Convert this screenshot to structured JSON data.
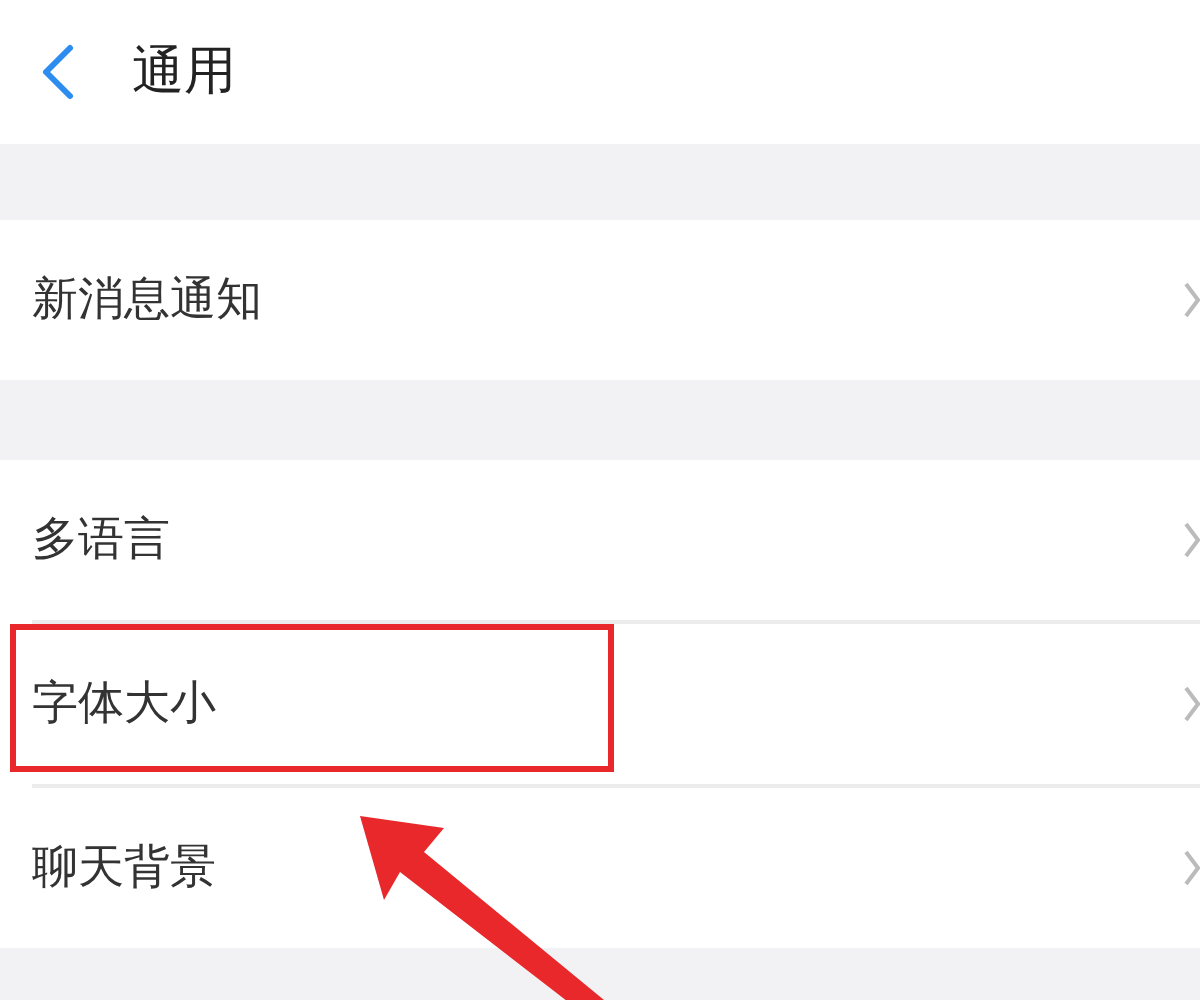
{
  "header": {
    "title": "通用"
  },
  "groups": [
    {
      "rows": [
        {
          "label": "新消息通知",
          "highlighted": false
        }
      ]
    },
    {
      "rows": [
        {
          "label": "多语言",
          "highlighted": false
        },
        {
          "label": "字体大小",
          "highlighted": true
        },
        {
          "label": "聊天背景",
          "highlighted": false
        }
      ]
    }
  ]
}
